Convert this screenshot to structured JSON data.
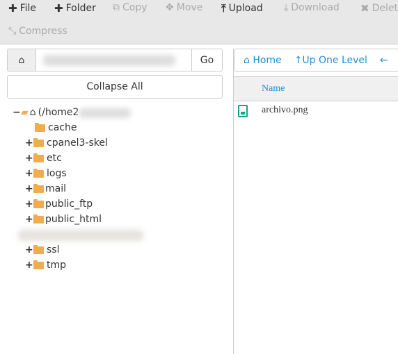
{
  "toolbar": {
    "items": [
      {
        "label": "File",
        "icon": "plus-icon",
        "enabled": true
      },
      {
        "label": "Folder",
        "icon": "plus-icon",
        "enabled": true
      },
      {
        "label": "Copy",
        "icon": "copy-icon",
        "enabled": false
      },
      {
        "label": "Move",
        "icon": "move-arrows-icon",
        "enabled": false
      },
      {
        "label": "Upload",
        "icon": "upload-icon",
        "enabled": true
      },
      {
        "label": "Download",
        "icon": "download-icon",
        "enabled": false
      },
      {
        "label": "Delete",
        "icon": "close-icon",
        "enabled": false
      },
      {
        "label": "Compress",
        "icon": "compress-icon",
        "enabled": false
      }
    ]
  },
  "pathbar": {
    "go_label": "Go"
  },
  "collapse_label": "Collapse All",
  "tree": {
    "root_label": "(/home2",
    "items": [
      "cache",
      "cpanel3-skel",
      "etc",
      "logs",
      "mail",
      "public_ftp",
      "public_html",
      "ssl",
      "tmp"
    ]
  },
  "nav": {
    "home": "Home",
    "up": "Up One Level"
  },
  "table": {
    "header_name": "Name",
    "files": [
      "archivo.png"
    ]
  },
  "colors": {
    "accent": "#1f8dd6",
    "folder": "#f0ad4e",
    "file_icon": "#16a085"
  }
}
